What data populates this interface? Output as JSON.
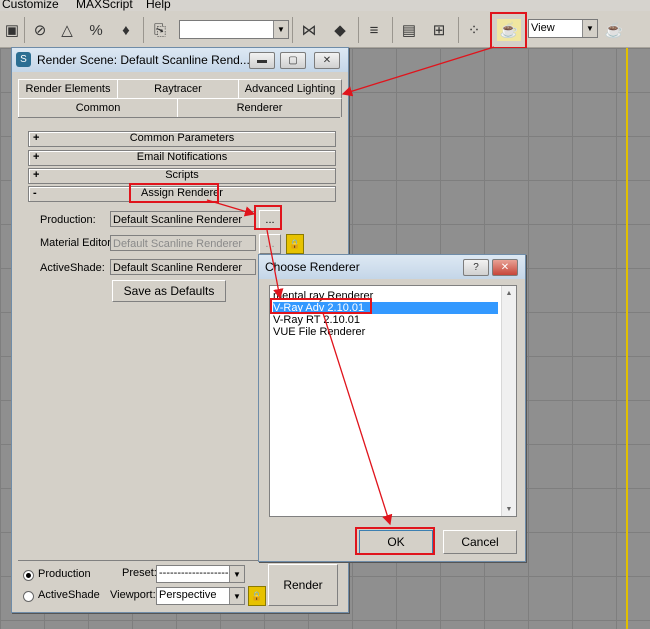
{
  "menubar": {
    "items": [
      "Customize",
      "MAXScript",
      "Help"
    ]
  },
  "toolbar": {
    "view_select": "View",
    "annotation_color": "#e0141c"
  },
  "render_dialog": {
    "title": "Render Scene: Default Scanline Rend...",
    "tabs_row1": [
      "Render Elements",
      "Raytracer",
      "Advanced Lighting"
    ],
    "tabs_row2": [
      "Common",
      "Renderer"
    ],
    "rollouts": [
      {
        "sign": "+",
        "label": "Common Parameters"
      },
      {
        "sign": "+",
        "label": "Email Notifications"
      },
      {
        "sign": "+",
        "label": "Scripts"
      },
      {
        "sign": "-",
        "label": "Assign Renderer"
      }
    ],
    "production_label": "Production:",
    "production_value": "Default Scanline Renderer",
    "material_editor_label": "Material Editor:",
    "material_editor_value": "Default Scanline Renderer",
    "activeshade_label": "ActiveShade:",
    "activeshade_value": "Default Scanline Renderer",
    "browse_label": "...",
    "save_defaults_label": "Save as Defaults",
    "mode_production_label": "Production",
    "mode_activeshade_label": "ActiveShade",
    "preset_label": "Preset:",
    "preset_value": "--------------------",
    "viewport_label": "Viewport:",
    "viewport_value": "Perspective",
    "render_label": "Render"
  },
  "choose_dialog": {
    "title": "Choose Renderer",
    "help_label": "?",
    "items": [
      "mental ray Renderer",
      "V-Ray Adv 2.10.01",
      "V-Ray RT 2.10.01",
      "VUE File Renderer"
    ],
    "selected_index": 1,
    "ok_label": "OK",
    "cancel_label": "Cancel"
  }
}
